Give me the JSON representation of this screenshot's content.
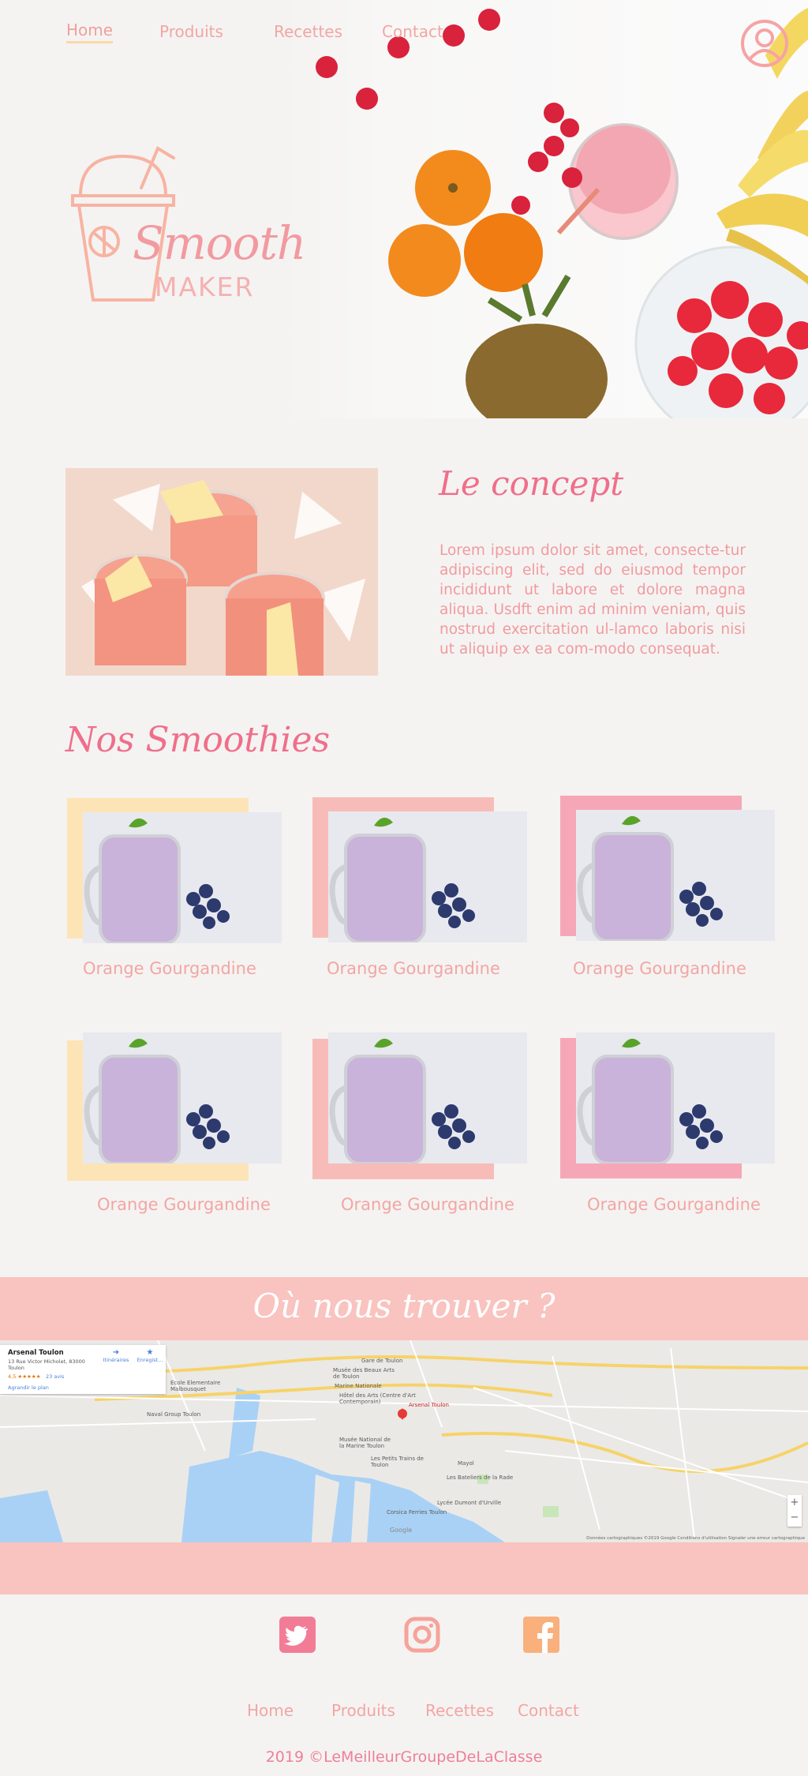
{
  "nav": {
    "items": [
      {
        "label": "Home",
        "active": true
      },
      {
        "label": "Produits"
      },
      {
        "label": "Recettes"
      },
      {
        "label": "Contact"
      }
    ]
  },
  "brand": {
    "script": "Smooth",
    "word": "MAKER"
  },
  "concept": {
    "title": "Le concept",
    "text": "Lorem ipsum dolor sit amet, consecte-tur adipiscing elit, sed do eiusmod tempor incididunt ut labore et dolore magna aliqua. Usdft enim ad minim veniam, quis nostrud exercitation ul-lamco laboris nisi ut aliquip ex ea com-modo consequat."
  },
  "products": {
    "title": "Nos Smoothies",
    "items": [
      {
        "name": "Orange Gourgandine",
        "frame_color": "#fde4b6"
      },
      {
        "name": "Orange Gourgandine",
        "frame_color": "#f8bcb8"
      },
      {
        "name": "Orange Gourgandine",
        "frame_color": "#f6a7b7"
      },
      {
        "name": "Orange Gourgandine",
        "frame_color": "#fde4b6"
      },
      {
        "name": "Orange Gourgandine",
        "frame_color": "#f8bcb8"
      },
      {
        "name": "Orange Gourgandine",
        "frame_color": "#f6a7b7"
      }
    ]
  },
  "find_us": {
    "title": "Où nous trouver ?",
    "map": {
      "place_name": "Arsenal Toulon",
      "address": "13 Rue Victor Micholet, 83000 Toulon",
      "rating": "4,5 ★★★★★",
      "reviews": "23 avis",
      "enlarge_link": "Agrandir le plan",
      "directions": "Itinéraires",
      "save": "Enregist...",
      "pin_label": "Arsenal Toulon",
      "labels": [
        "Gare de Toulon",
        "Musée des Beaux Arts de Toulon",
        "Marine Nationale",
        "Hôtel des Arts (Centre d'Art Contemporain)",
        "Musée National de la Marine Toulon",
        "Les Petits Trains de Toulon",
        "Les Bateliers de la Rade",
        "Lycée Dumont d'Urville",
        "Corsica Ferries Toulon",
        "Naval Group Toulon",
        "Ecole Elementaire Malbousquet",
        "Mayol"
      ],
      "attribution": "Données cartographiques ©2019 Google   Conditions d'utilisation   Signaler une erreur cartographique",
      "google": "Google"
    }
  },
  "social": [
    {
      "icon": "twitter-icon",
      "color": "#f27c96"
    },
    {
      "icon": "instagram-icon",
      "color": "#f6a39a"
    },
    {
      "icon": "facebook-icon",
      "color": "#f9b07c"
    }
  ],
  "footer": {
    "nav": [
      "Home",
      "Produits",
      "Recettes",
      "Contact"
    ],
    "copyright": "2019 ©LeMeilleurGroupeDeLaClasse"
  }
}
